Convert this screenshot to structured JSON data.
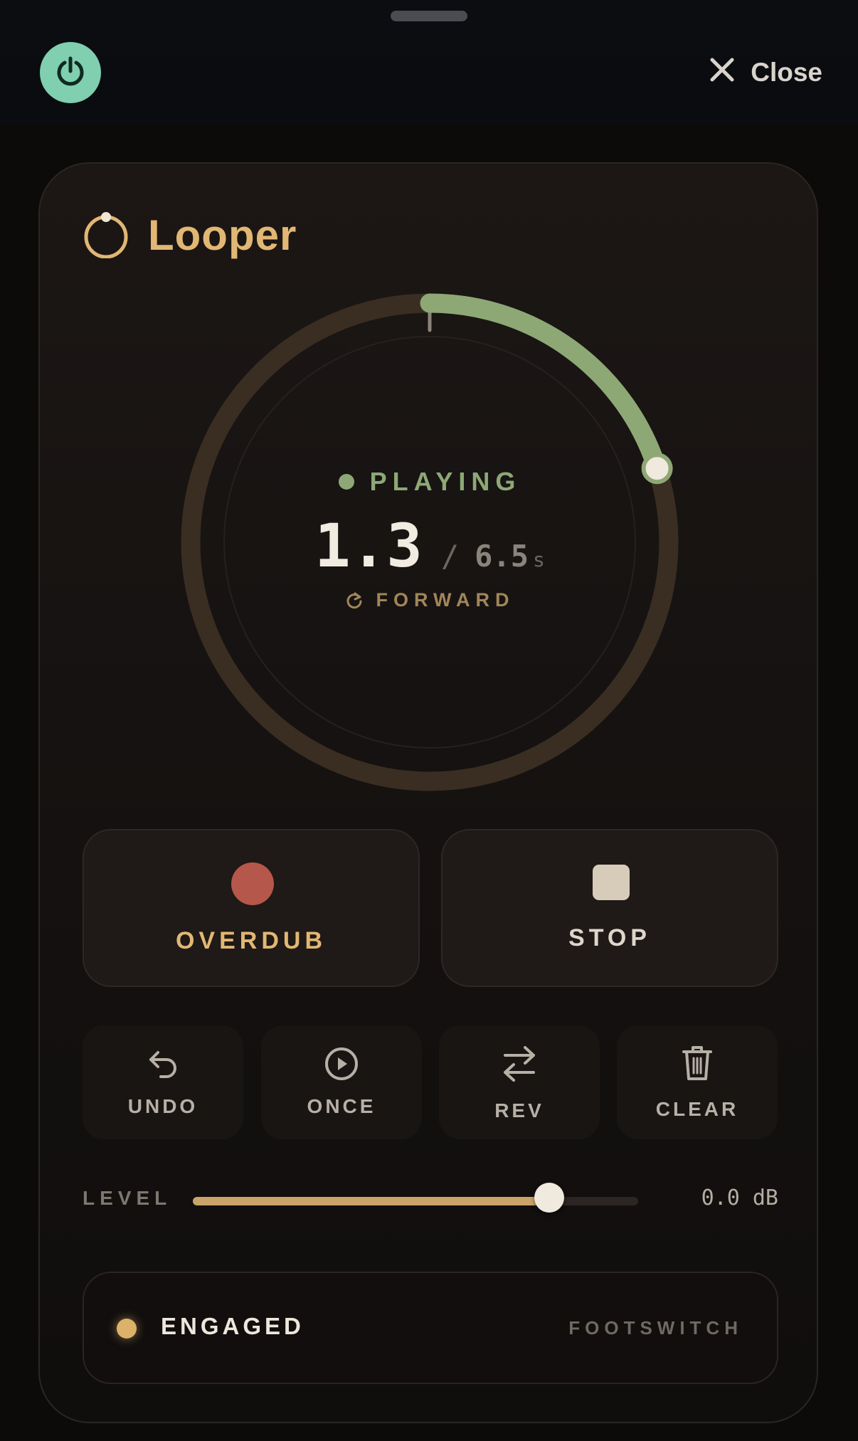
{
  "header": {
    "power_icon": "power-icon",
    "close_icon": "close-icon",
    "close_label": "Close"
  },
  "looper": {
    "title": "Looper",
    "title_icon": "loop-ring-icon",
    "state": "PLAYING",
    "position": "1.3",
    "separator": "/",
    "length": "6.5",
    "length_unit": "s",
    "direction": "FORWARD",
    "direction_icon": "refresh-icon",
    "progress_fraction": 0.2,
    "colors": {
      "accent": "#e1b773",
      "playing": "#8da875",
      "record": "#b5574a",
      "power": "#7fcfb0"
    }
  },
  "transport": {
    "overdub_label": "OVERDUB",
    "overdub_icon": "record-dot-icon",
    "stop_label": "STOP",
    "stop_icon": "stop-square-icon"
  },
  "actions": [
    {
      "label": "UNDO",
      "icon": "undo-icon"
    },
    {
      "label": "ONCE",
      "icon": "play-once-icon"
    },
    {
      "label": "REV",
      "icon": "reverse-arrows-icon"
    },
    {
      "label": "CLEAR",
      "icon": "trash-icon"
    }
  ],
  "level": {
    "label": "LEVEL",
    "value_text": "0.0 dB",
    "fraction": 0.8
  },
  "footswitch": {
    "state_label": "ENGAGED",
    "label": "FOOTSWITCH"
  }
}
